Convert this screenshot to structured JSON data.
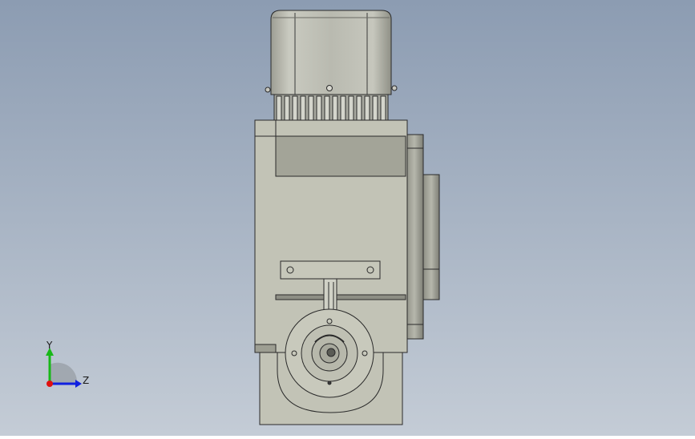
{
  "app": {
    "title": "",
    "background_top": "#8c9cb2",
    "background_bottom": "#c4ccd6"
  },
  "model": {
    "body_color": "#c2c3b6",
    "shade_color": "#9d9e92",
    "edge_color": "#2a2a2a",
    "motor_color": "#b9bab0"
  },
  "triad": {
    "x_axis_color": "#e01010",
    "y_axis_color": "#18b818",
    "z_axis_color": "#1020e0",
    "y_label": "Y",
    "z_label": "Z"
  }
}
